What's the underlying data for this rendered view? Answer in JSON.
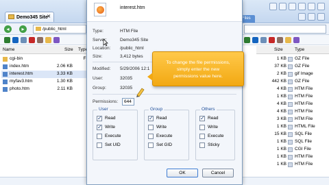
{
  "window": {
    "site_tab_label": "Demo345 Site",
    "files_tab_label": "Files"
  },
  "nav": {
    "path": "/public_html"
  },
  "left_pane": {
    "columns": [
      "Name",
      "Size",
      "Type"
    ],
    "rows": [
      {
        "name": "cgi-bin",
        "size": "",
        "type": "File",
        "icon": "folder-icon"
      },
      {
        "name": "index.htm",
        "size": "2.06 KB",
        "type": "",
        "icon": "html-file-icon"
      },
      {
        "name": "interest.htm",
        "size": "3.33 KB",
        "type": "",
        "icon": "html-file-icon"
      },
      {
        "name": "myfav3.htm",
        "size": "1.30 KB",
        "type": "",
        "icon": "html-file-icon"
      },
      {
        "name": "photo.htm",
        "size": "2.11 KB",
        "type": "",
        "icon": "html-file-icon"
      }
    ]
  },
  "right_pane": {
    "columns": [
      "Size",
      "Type"
    ],
    "rows": [
      {
        "size": "1 KB",
        "type": "GZ File"
      },
      {
        "size": "37 KB",
        "type": "GZ File"
      },
      {
        "size": "2 KB",
        "type": "gif Image"
      },
      {
        "size": "442 KB",
        "type": "GZ File"
      },
      {
        "size": "4 KB",
        "type": "HTM File"
      },
      {
        "size": "1 KB",
        "type": "HTM File"
      },
      {
        "size": "4 KB",
        "type": "HTM File"
      },
      {
        "size": "4 KB",
        "type": "HTM File"
      },
      {
        "size": "3 KB",
        "type": "HTM File"
      },
      {
        "size": "1 KB",
        "type": "HTML File"
      },
      {
        "size": "15 KB",
        "type": "SQL File"
      },
      {
        "size": "1 KB",
        "type": "SQL File"
      },
      {
        "size": "1 KB",
        "type": "CGI File"
      },
      {
        "size": "1 KB",
        "type": "HTM File"
      },
      {
        "size": "1 KB",
        "type": "HTM File"
      }
    ]
  },
  "dialog": {
    "file_name": "interest.htm",
    "properties": [
      {
        "label": "Type:",
        "value": "HTM File"
      },
      {
        "label": "Server:",
        "value": "Demo345 Site"
      },
      {
        "label": "Location:",
        "value": "/public_html"
      },
      {
        "label": "Size:",
        "value": "3,412 bytes"
      }
    ],
    "modified_label": "Modified:",
    "modified_value": "5/29/2006 12:1",
    "user_label": "User:",
    "user_value": "32035",
    "group_label": "Group:",
    "group_value": "32035",
    "permissions_label": "Permissions:",
    "permissions_value": "644",
    "groups": [
      {
        "title": "User",
        "options": [
          {
            "label": "Read",
            "checked": true
          },
          {
            "label": "Write",
            "checked": true
          },
          {
            "label": "Execute",
            "checked": false
          },
          {
            "label": "Set UID",
            "checked": false
          }
        ]
      },
      {
        "title": "Group",
        "options": [
          {
            "label": "Read",
            "checked": true
          },
          {
            "label": "Write",
            "checked": false
          },
          {
            "label": "Execute",
            "checked": false
          },
          {
            "label": "Set GID",
            "checked": false
          }
        ]
      },
      {
        "title": "Others",
        "options": [
          {
            "label": "Read",
            "checked": true
          },
          {
            "label": "Write",
            "checked": false
          },
          {
            "label": "Execute",
            "checked": false
          },
          {
            "label": "Sticky",
            "checked": false
          }
        ]
      }
    ],
    "ok_label": "OK",
    "cancel_label": "Cancel"
  },
  "tooltip": {
    "line1": "To change the file permissions,",
    "line2": "simply enter the new",
    "line3": "permissions value here."
  },
  "colors": {
    "accent": "#3d7bd2",
    "tooltip": "#f2a812",
    "check": "#1b3f7a"
  }
}
